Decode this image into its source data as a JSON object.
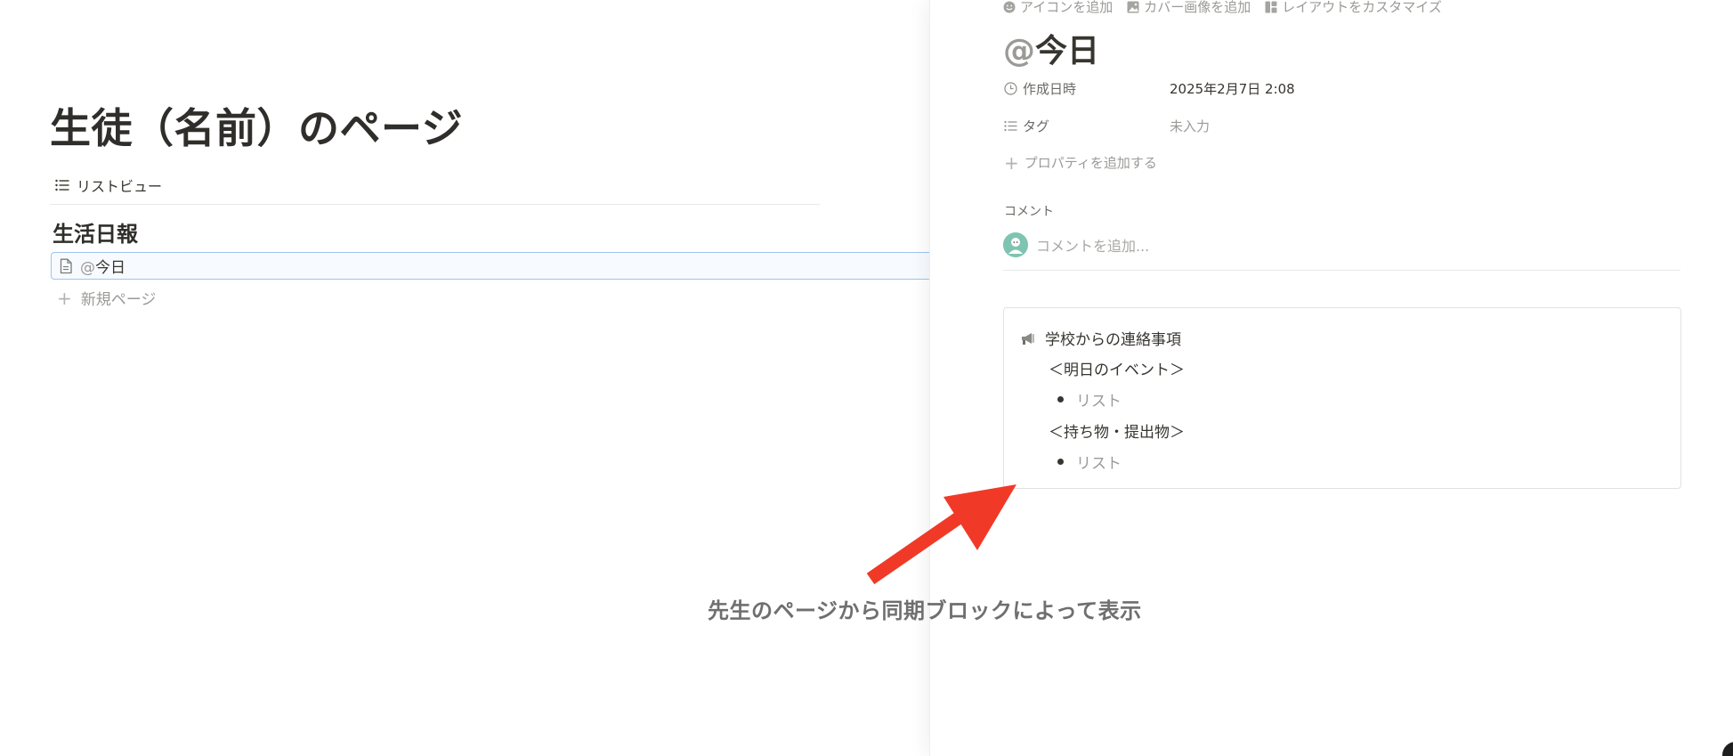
{
  "main": {
    "title": "生徒（名前）のページ",
    "view_tab": {
      "label": "リストビュー",
      "icon": "list-icon"
    },
    "database_title": "生活日報",
    "rows": [
      {
        "at": "@",
        "label": "今日",
        "icon": "document-icon",
        "selected": true
      }
    ],
    "new_page_label": "新規ページ"
  },
  "panel": {
    "actions": [
      {
        "label": "アイコンを追加",
        "icon": "smiley-icon"
      },
      {
        "label": "カバー画像を追加",
        "icon": "image-icon"
      },
      {
        "label": "レイアウトをカスタマイズ",
        "icon": "layout-icon"
      }
    ],
    "title_at": "@",
    "title_text": "今日",
    "properties": [
      {
        "name": "作成日時",
        "value": "2025年2月7日 2:08",
        "icon": "clock-icon"
      },
      {
        "name": "タグ",
        "value": "未入力",
        "icon": "list-icon"
      }
    ],
    "add_property_label": "プロパティを追加する",
    "comments_label": "コメント",
    "comment_placeholder": "コメントを追加...",
    "synced_block": {
      "icon": "megaphone-icon",
      "title": "学校からの連絡事項",
      "sections": [
        {
          "heading": "＜明日のイベント＞",
          "bullet": "リスト"
        },
        {
          "heading": "＜持ち物・提出物＞",
          "bullet": "リスト"
        }
      ]
    }
  },
  "annotation": {
    "text": "先生のページから同期ブロックによって表示",
    "arrow_color": "#f03a27"
  },
  "colors": {
    "selection_border": "#9fc4ec",
    "text_primary": "#37352f",
    "text_muted": "#9b9a97",
    "annotation_arrow": "#f03a27"
  }
}
